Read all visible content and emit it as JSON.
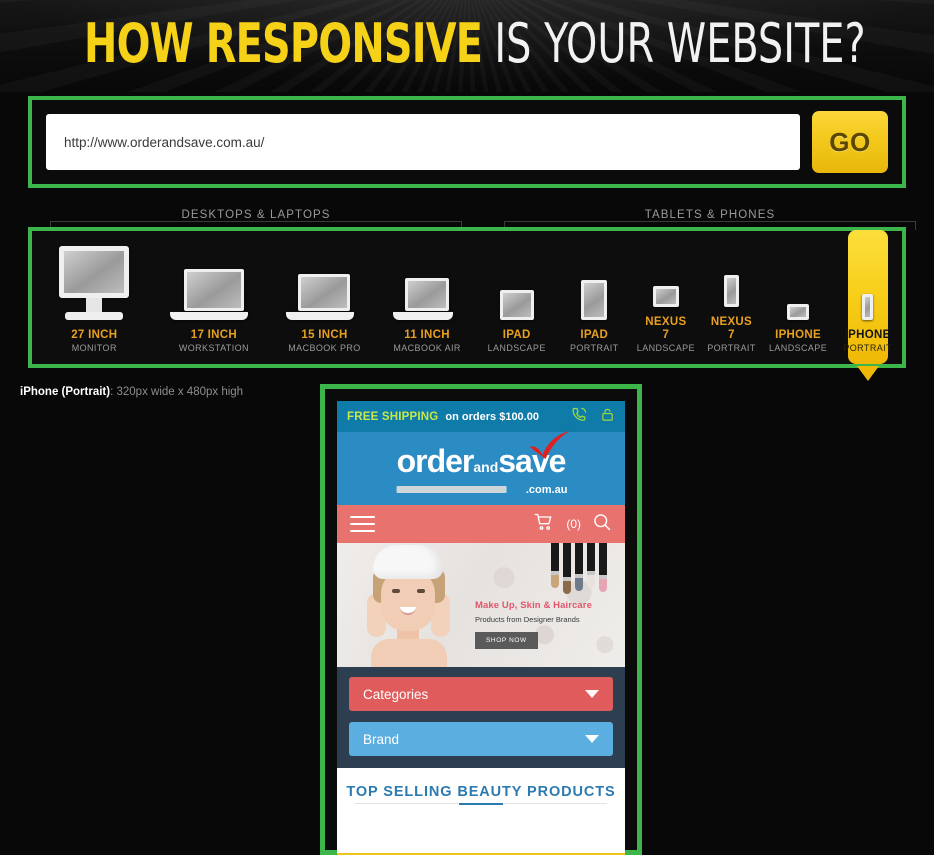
{
  "header": {
    "title_highlight": "HOW RESPONSIVE",
    "title_rest": "IS YOUR WEBSITE?"
  },
  "url_bar": {
    "value": "http://www.orderandsave.com.au/",
    "placeholder": "http://",
    "go_label": "GO"
  },
  "sections": {
    "desktops_label": "DESKTOPS & LAPTOPS",
    "tablets_label": "TABLETS & PHONES"
  },
  "devices": [
    {
      "icon": "monitor-icon",
      "label": "27 INCH",
      "sub": "MONITOR",
      "selected": false
    },
    {
      "icon": "laptop-large-icon",
      "label": "17 INCH",
      "sub": "WORKSTATION",
      "selected": false
    },
    {
      "icon": "laptop-medium-icon",
      "label": "15 INCH",
      "sub": "MACBOOK PRO",
      "selected": false
    },
    {
      "icon": "laptop-small-icon",
      "label": "11 INCH",
      "sub": "MACBOOK AIR",
      "selected": false
    },
    {
      "icon": "tablet-landscape-icon",
      "label": "IPAD",
      "sub": "LANDSCAPE",
      "selected": false
    },
    {
      "icon": "tablet-portrait-icon",
      "label": "IPAD",
      "sub": "PORTRAIT",
      "selected": false
    },
    {
      "icon": "nexus-landscape-icon",
      "label": "NEXUS 7",
      "sub": "LANDSCAPE",
      "selected": false
    },
    {
      "icon": "nexus-portrait-icon",
      "label": "NEXUS 7",
      "sub": "PORTRAIT",
      "selected": false
    },
    {
      "icon": "phone-landscape-icon",
      "label": "IPHONE",
      "sub": "LANDSCAPE",
      "selected": false
    },
    {
      "icon": "phone-portrait-icon",
      "label": "IPHONE",
      "sub": "PORTRAIT",
      "selected": true
    }
  ],
  "caption": {
    "device": "iPhone (Portrait)",
    "dimensions": ": 320px wide x 480px high"
  },
  "preview": {
    "shipping": {
      "free_label": "FREE SHIPPING",
      "terms": "on orders $100.00",
      "phone_icon": "phone-call-icon",
      "lock_icon": "padlock-icon"
    },
    "logo": {
      "word1": "order",
      "word_and": "and",
      "word2": "save",
      "domain": ".com.au",
      "check_icon": "red-check-icon"
    },
    "nav": {
      "menu_icon": "hamburger-menu-icon",
      "cart_icon": "shopping-cart-icon",
      "cart_count": "(0)",
      "search_icon": "search-icon"
    },
    "banner": {
      "heading": "Make Up, Skin & Haircare",
      "subheading": "Products from Designer Brands",
      "cta": "SHOP NOW"
    },
    "filters": [
      {
        "label": "Categories",
        "color": "#E05C5C"
      },
      {
        "label": "Brand",
        "color": "#5BAEE0"
      }
    ],
    "top_selling_title": "TOP SELLING BEAUTY PRODUCTS"
  },
  "colors": {
    "accent_green": "#3CB54A",
    "accent_yellow": "#F5D118",
    "device_label": "#E8A020",
    "preview_navy": "#2C3E50",
    "preview_salmon": "#E8726E",
    "preview_blue": "#2B8CC4",
    "preview_teal": "#0E7BA8"
  }
}
